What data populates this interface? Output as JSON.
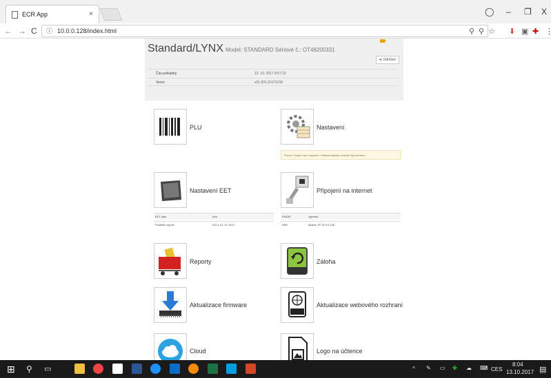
{
  "browser": {
    "tab_title": "ECR App",
    "tab_close": "×",
    "url": "10.0.0.128/index.html",
    "back": "←",
    "forward": "→",
    "reload": "C",
    "window_min": "–",
    "window_restore": "❐",
    "window_close": "X"
  },
  "header": {
    "title": "Standard/LYNX",
    "model_line": "Model: STANDARD Sériové č.: OT48200331",
    "logout_label": "Odhlásit",
    "rows": [
      {
        "label": "Čas pokladny",
        "value": "13. 10. 2017 8:57:22"
      },
      {
        "label": "Verze",
        "value": "v01.001.20171016"
      }
    ]
  },
  "tiles": {
    "plu": "PLU",
    "settings": "Nastavení",
    "eet_settings": "Nastavení EET",
    "internet": "Připojení na internet",
    "reports": "Reporty",
    "backup": "Záloha",
    "firmware": "Aktualizace firmware",
    "web_update": "Aktualizace webového rozhraní",
    "cloud": "Cloud",
    "logo": "Logo na účtence"
  },
  "notice": "Pozor! 2 kopie není vytvořen. Většina tabulek nemůže být měněna",
  "eet_stats": [
    {
      "label": "EET stav:",
      "value": "Ano"
    },
    {
      "label": "Poslední report:",
      "value": "#11 v 13. 10. 2017"
    }
  ],
  "net_stats": [
    {
      "label": "RNDIS",
      "value": "Vypnuto"
    },
    {
      "label": "WiFi",
      "value": "Aktivní, IP 10.0.0.128"
    }
  ],
  "taskbar": {
    "time": "8:04",
    "date": "13.10.2017",
    "lang": "CES"
  }
}
